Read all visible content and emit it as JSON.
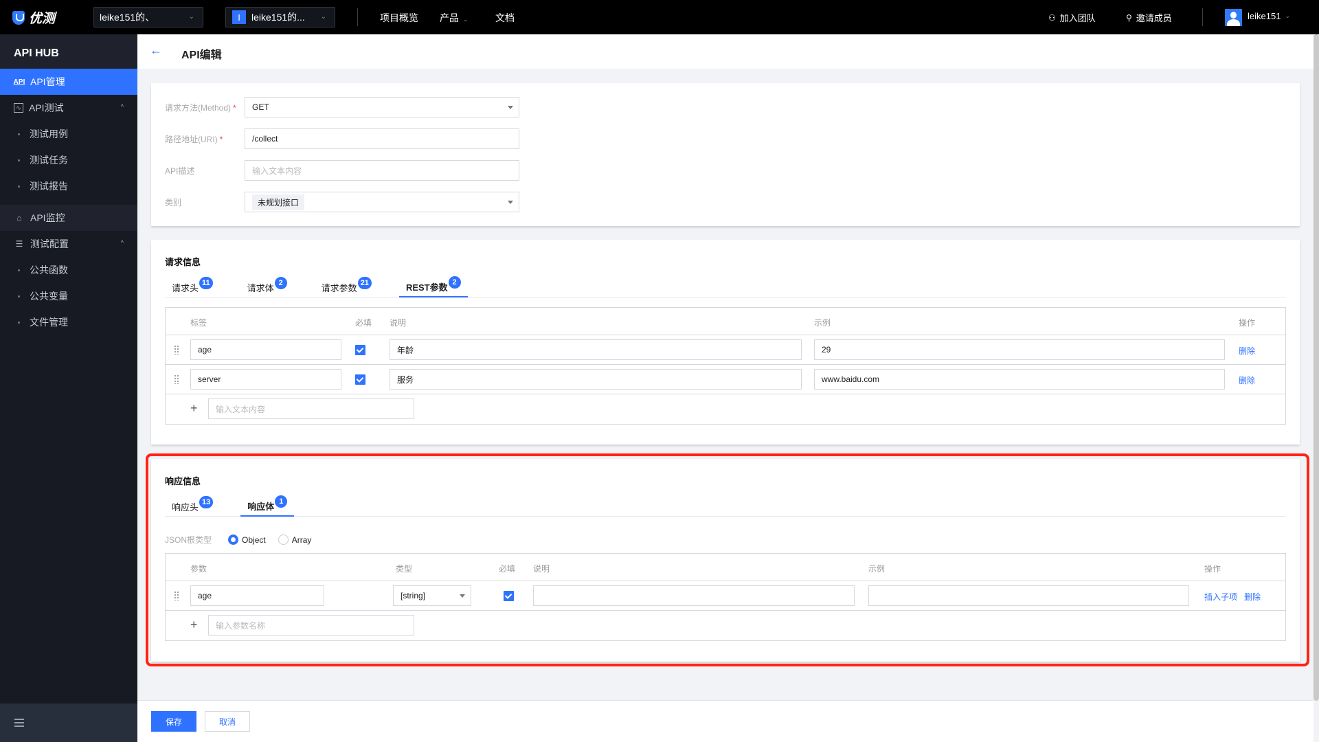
{
  "topbar": {
    "brand": "优测",
    "org_select": "leike151的、",
    "project_initial": "I",
    "project_select": "leike151的...",
    "nav": [
      {
        "label": "项目概览"
      },
      {
        "label": "产品",
        "has_dropdown": true
      },
      {
        "label": "文档"
      }
    ],
    "join_team": "加入团队",
    "invite_member": "邀请成员",
    "username": "leike151"
  },
  "sidebar": {
    "title": "API HUB",
    "items": [
      {
        "label": "API管理",
        "icon": "api-icon",
        "active": true
      },
      {
        "label": "API测试",
        "icon": "chart-icon",
        "expanded": true,
        "children": [
          "测试用例",
          "测试任务",
          "测试报告"
        ]
      },
      {
        "label": "API监控",
        "icon": "monitor-icon"
      },
      {
        "label": "测试配置",
        "icon": "sliders-icon",
        "expanded": true,
        "children": [
          "公共函数",
          "公共变量",
          "文件管理"
        ]
      }
    ]
  },
  "header": {
    "title": "API编辑"
  },
  "basic_form": {
    "method_label": "请求方法(Method)",
    "method_value": "GET",
    "uri_label": "路径地址(URI)",
    "uri_value": "/collect",
    "desc_label": "API描述",
    "desc_placeholder": "输入文本内容",
    "category_label": "类别",
    "category_value": "未规划接口"
  },
  "request": {
    "title": "请求信息",
    "tabs": [
      {
        "label": "请求头",
        "count": "11"
      },
      {
        "label": "请求体",
        "count": "2"
      },
      {
        "label": "请求参数",
        "count": "21"
      },
      {
        "label": "REST参数",
        "count": "2",
        "active": true
      }
    ],
    "columns": [
      "标签",
      "必填",
      "说明",
      "示例",
      "操作"
    ],
    "rows": [
      {
        "name": "age",
        "required": true,
        "desc": "年龄",
        "example": "29",
        "action": "删除"
      },
      {
        "name": "server",
        "required": true,
        "desc": "服务",
        "example": "www.baidu.com",
        "action": "删除"
      }
    ],
    "add_placeholder": "输入文本内容"
  },
  "response": {
    "title": "响应信息",
    "tabs": [
      {
        "label": "响应头",
        "count": "13"
      },
      {
        "label": "响应体",
        "count": "1",
        "active": true
      }
    ],
    "json_root_label": "JSON根类型",
    "json_root_options": [
      "Object",
      "Array"
    ],
    "json_root_selected": "Object",
    "columns": [
      "参数",
      "类型",
      "必填",
      "说明",
      "示例",
      "操作"
    ],
    "rows": [
      {
        "name": "age",
        "type": "[string]",
        "required": true,
        "desc": "",
        "example": "",
        "actions": [
          "插入子项",
          "删除"
        ]
      }
    ],
    "add_placeholder": "输入参数名称"
  },
  "footer": {
    "save": "保存",
    "cancel": "取消"
  },
  "colors": {
    "accent": "#2f72ff",
    "highlight_box": "#ff2416",
    "topbar": "#000000",
    "sidebar": "#171a23"
  }
}
